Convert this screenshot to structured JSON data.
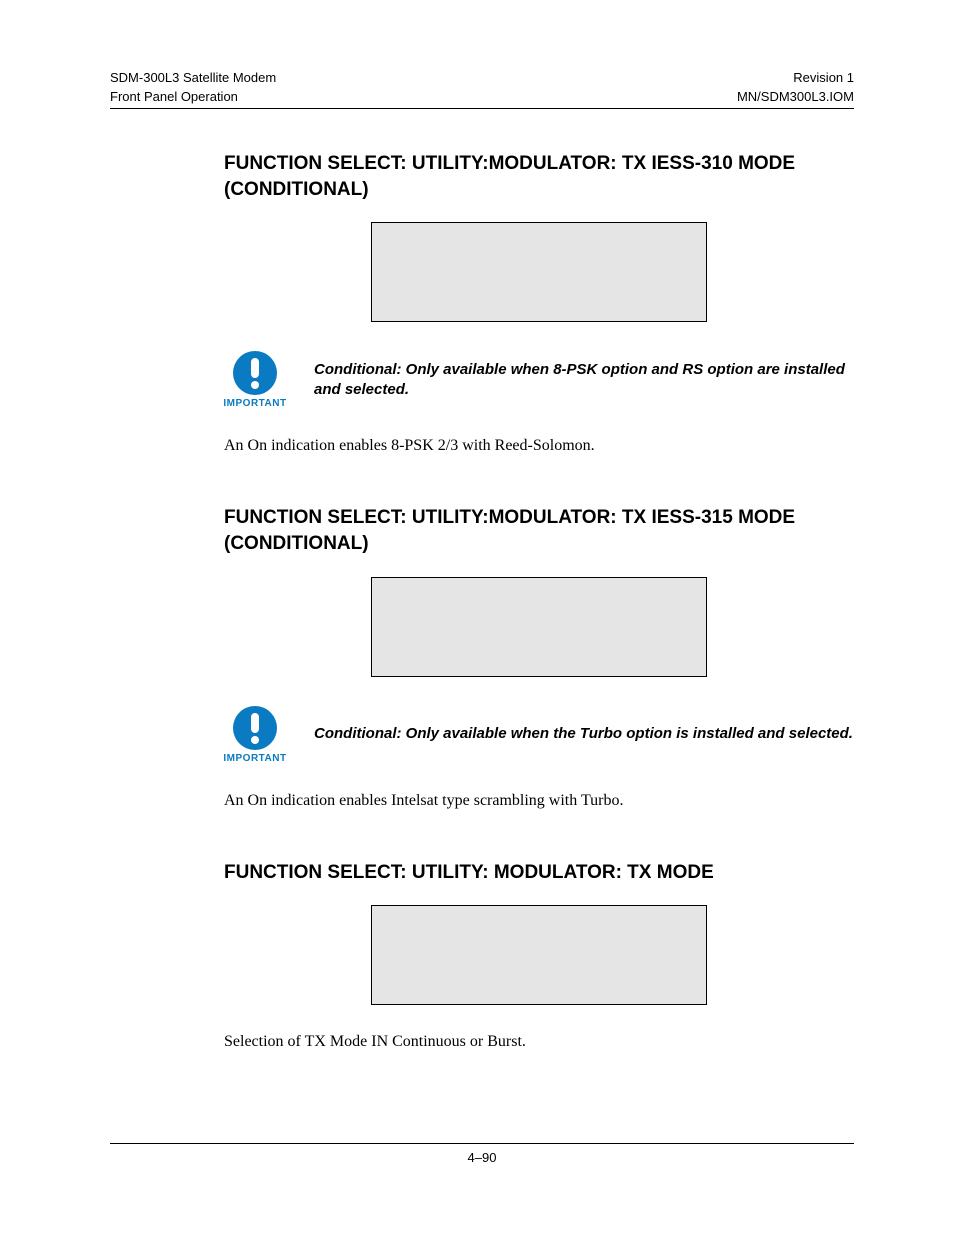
{
  "header": {
    "left_line1": "SDM-300L3 Satellite Modem",
    "left_line2": "Front Panel Operation",
    "right_line1": "Revision 1",
    "right_line2": "MN/SDM300L3.IOM"
  },
  "sections": [
    {
      "heading": "FUNCTION SELECT: UTILITY:MODULATOR: TX IESS-310 MODE (CONDITIONAL)",
      "important_label": "IMPORTANT",
      "important_text": "Conditional: Only available when 8-PSK option and RS option are installed and selected.",
      "body": "An On indication enables 8-PSK 2/3 with Reed-Solomon."
    },
    {
      "heading": "FUNCTION SELECT: UTILITY:MODULATOR: TX IESS-315 MODE (CONDITIONAL)",
      "important_label": "IMPORTANT",
      "important_text": "Conditional: Only available when the Turbo option is installed and selected.",
      "body": "An On indication enables Intelsat type scrambling with Turbo."
    },
    {
      "heading": "FUNCTION SELECT: UTILITY: MODULATOR: TX MODE",
      "body": "Selection of TX Mode IN Continuous or Burst."
    }
  ],
  "footer": {
    "page_number": "4–90"
  }
}
